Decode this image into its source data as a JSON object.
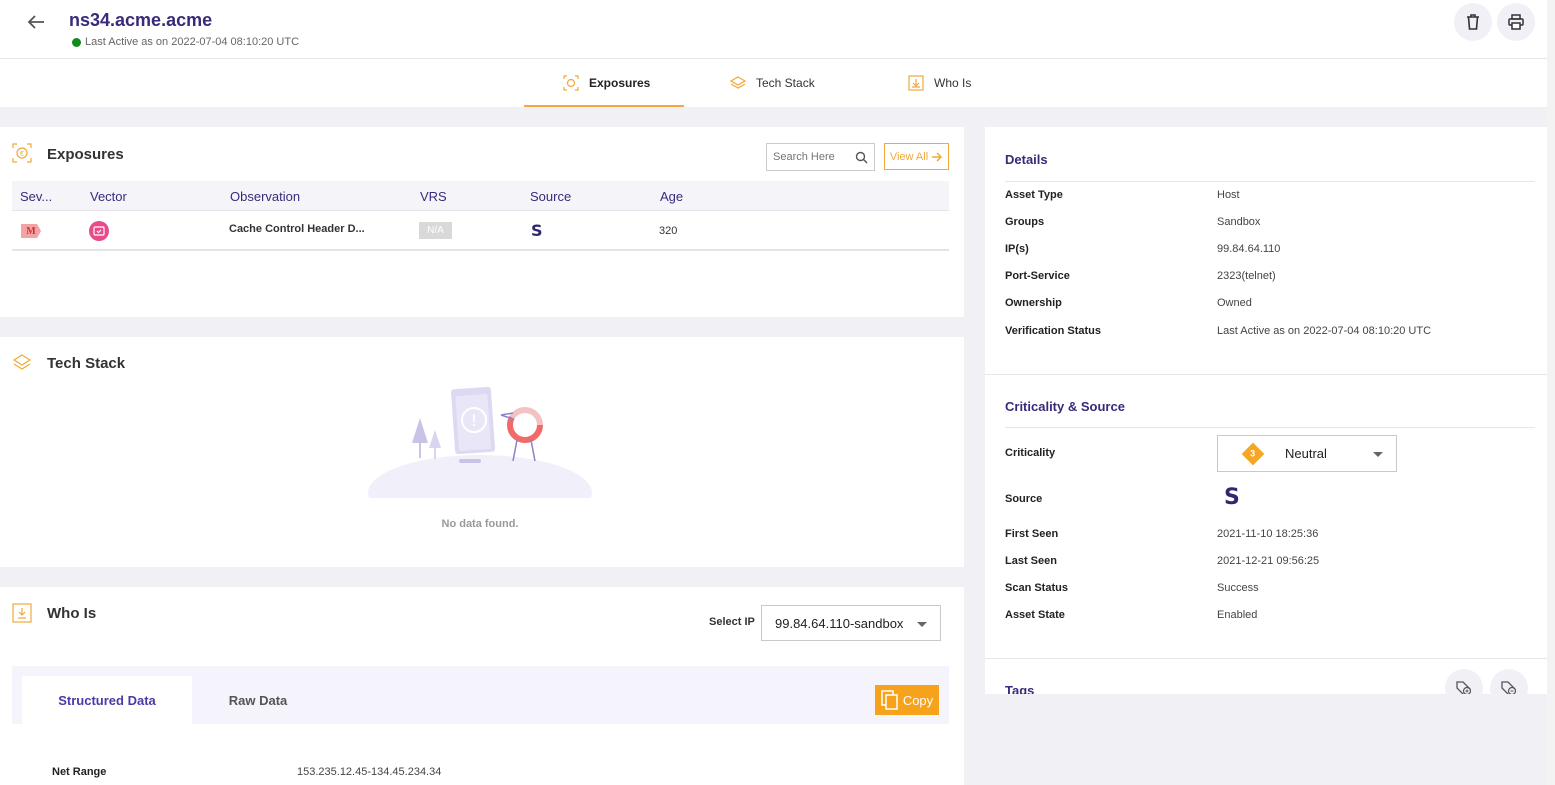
{
  "header": {
    "title": "ns34.acme.acme",
    "last_active": "Last Active as on 2022-07-04 08:10:20 UTC",
    "back_icon": "arrow-left-icon",
    "delete_icon": "trash-icon",
    "print_icon": "printer-icon"
  },
  "main_tabs": [
    {
      "label": "Exposures",
      "icon": "exposures-icon",
      "active": true
    },
    {
      "label": "Tech Stack",
      "icon": "layers-icon",
      "active": false
    },
    {
      "label": "Who Is",
      "icon": "download-box-icon",
      "active": false
    }
  ],
  "exposures": {
    "title": "Exposures",
    "search_placeholder": "Search Here",
    "view_all_label": "View All",
    "columns": [
      "Sev...",
      "Vector",
      "Observation",
      "VRS",
      "Source",
      "Age"
    ],
    "rows": [
      {
        "severity": "M",
        "vector_icon": "web-shield-icon",
        "observation": "Cache Control Header D...",
        "vrs": "N/A",
        "source": "S",
        "age": "320"
      }
    ]
  },
  "tech_stack": {
    "title": "Tech Stack",
    "empty_text": "No data found."
  },
  "who_is": {
    "title": "Who Is",
    "select_ip_label": "Select IP",
    "select_ip_value": "99.84.64.110-sandbox",
    "tabs": [
      {
        "label": "Structured Data",
        "active": true
      },
      {
        "label": "Raw Data",
        "active": false
      }
    ],
    "copy_label": "Copy",
    "fields": [
      {
        "label": "Net Range",
        "value": "153.235.12.45-134.45.234.34"
      }
    ]
  },
  "details": {
    "title": "Details",
    "fields": [
      {
        "label": "Asset Type",
        "value": "Host"
      },
      {
        "label": "Groups",
        "value": "Sandbox"
      },
      {
        "label": "IP(s)",
        "value": "99.84.64.110"
      },
      {
        "label": "Port-Service",
        "value": "2323(telnet)"
      },
      {
        "label": "Ownership",
        "value": "Owned"
      },
      {
        "label": "Verification Status",
        "value": "Last Active as on 2022-07-04 08:10:20 UTC"
      }
    ]
  },
  "criticality_source": {
    "title": "Criticality & Source",
    "criticality_label": "Criticality",
    "criticality_level": "3",
    "criticality_value": "Neutral",
    "source_label": "Source",
    "source_value": "S",
    "fields": [
      {
        "label": "First Seen",
        "value": "2021-11-10 18:25:36"
      },
      {
        "label": "Last Seen",
        "value": "2021-12-21 09:56:25"
      },
      {
        "label": "Scan Status",
        "value": "Success"
      },
      {
        "label": "Asset State",
        "value": "Enabled"
      }
    ]
  },
  "tags": {
    "title": "Tags",
    "add_tag_icon": "tag-add-icon",
    "remove_tag_icon": "tag-remove-icon"
  },
  "colors": {
    "accent": "#f0a93a",
    "brand": "#3b2a7a",
    "active_green": "#108a1e",
    "copy_orange": "#f7a21b"
  }
}
